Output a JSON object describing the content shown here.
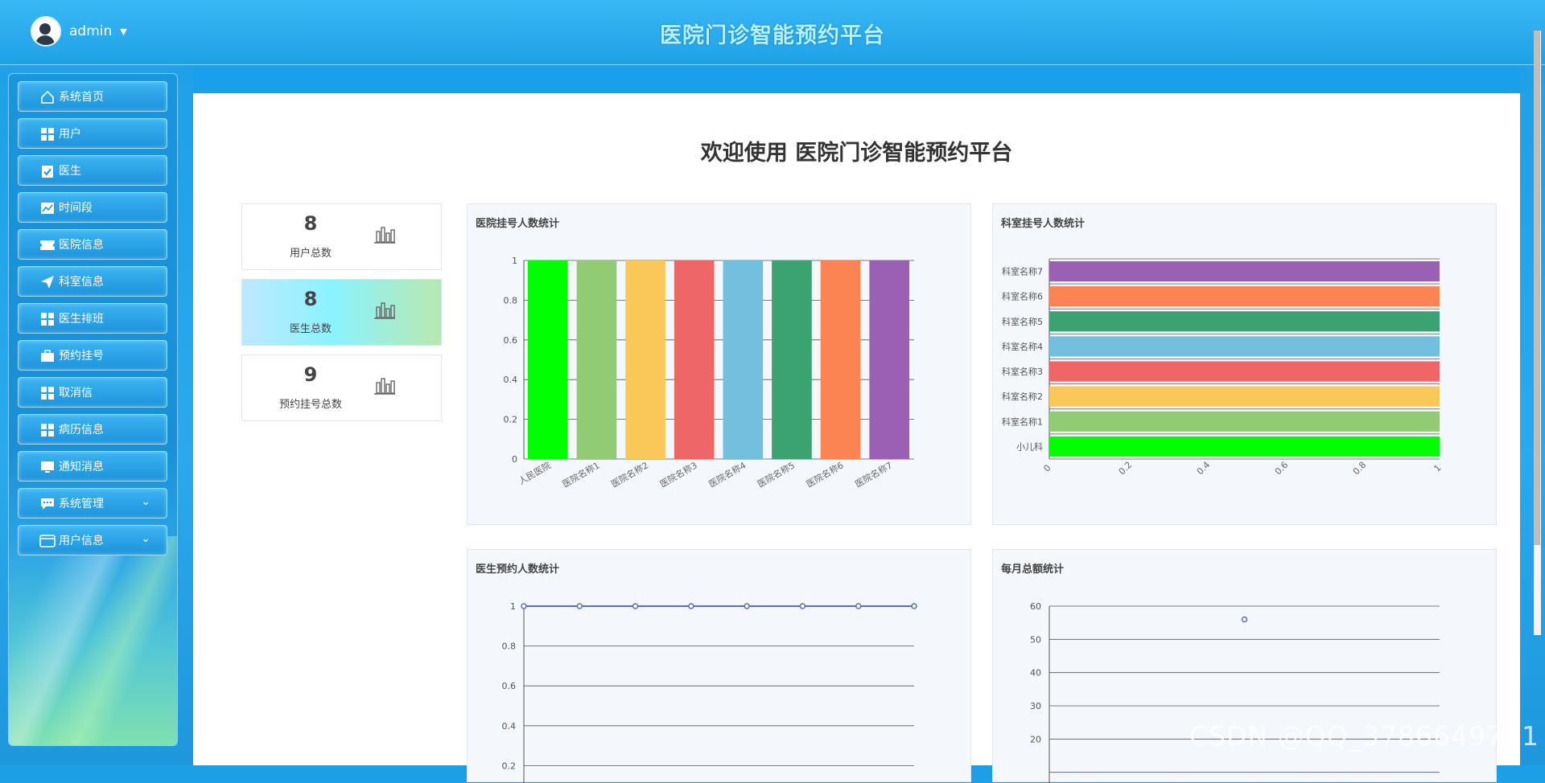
{
  "header": {
    "username": "admin",
    "caret": "▼",
    "app_title": "医院门诊智能预约平台"
  },
  "sidebar": {
    "items": [
      {
        "label": "系统首页",
        "icon": "home-icon"
      },
      {
        "label": "用户",
        "icon": "grid-icon"
      },
      {
        "label": "医生",
        "icon": "clipboard-icon"
      },
      {
        "label": "时间段",
        "icon": "trend-icon"
      },
      {
        "label": "医院信息",
        "icon": "ticket-icon"
      },
      {
        "label": "科室信息",
        "icon": "send-icon"
      },
      {
        "label": "医生排班",
        "icon": "grid-icon"
      },
      {
        "label": "预约挂号",
        "icon": "briefcase-icon"
      },
      {
        "label": "取消信",
        "icon": "grid-icon"
      },
      {
        "label": "病历信息",
        "icon": "grid-icon"
      },
      {
        "label": "通知消息",
        "icon": "monitor-icon"
      },
      {
        "label": "系统管理",
        "icon": "chat-icon",
        "expandable": true
      },
      {
        "label": "用户信息",
        "icon": "card-icon",
        "expandable": true
      }
    ]
  },
  "main": {
    "welcome": "欢迎使用 医院门诊智能预约平台",
    "stats": [
      {
        "value": "8",
        "label": "用户总数"
      },
      {
        "value": "8",
        "label": "医生总数"
      },
      {
        "value": "9",
        "label": "预约挂号总数"
      }
    ]
  },
  "chart_data": [
    {
      "type": "bar",
      "title": "医院挂号人数统计",
      "categories": [
        "人民医院",
        "医院名称1",
        "医院名称2",
        "医院名称3",
        "医院名称4",
        "医院名称5",
        "医院名称6",
        "医院名称7"
      ],
      "values": [
        1,
        1,
        1,
        1,
        1,
        1,
        1,
        1
      ],
      "colors": [
        "#00ff00",
        "#91cc75",
        "#fac858",
        "#ee6666",
        "#73c0de",
        "#3ba272",
        "#fc8452",
        "#9a60b4"
      ],
      "ylim": [
        0,
        1
      ],
      "yticks": [
        "0",
        "0.2",
        "0.4",
        "0.6",
        "0.8",
        "1"
      ]
    },
    {
      "type": "bar",
      "orientation": "horizontal",
      "title": "科室挂号人数统计",
      "categories": [
        "小儿科",
        "科室名称1",
        "科室名称2",
        "科室名称3",
        "科室名称4",
        "科室名称5",
        "科室名称6",
        "科室名称7"
      ],
      "category_labels_visible": [
        "小儿科",
        "科室名称1",
        "科室名称2",
        "科室名称3",
        "科室名称4",
        "科室名称5",
        "科室名称6",
        "科室名称7"
      ],
      "values": [
        1,
        1,
        1,
        1,
        1,
        1,
        1,
        1
      ],
      "colors": [
        "#00ff00",
        "#91cc75",
        "#fac858",
        "#ee6666",
        "#73c0de",
        "#3ba272",
        "#fc8452",
        "#9a60b4"
      ],
      "xlim": [
        0,
        1
      ],
      "xticks": [
        "0",
        "0.2",
        "0.4",
        "0.6",
        "0.8",
        "1"
      ]
    },
    {
      "type": "line",
      "title": "医生预约人数统计",
      "values": [
        1,
        1,
        1,
        1,
        1,
        1,
        1,
        1
      ],
      "ylim": [
        0,
        1
      ],
      "yticks_visible": [
        "0.2",
        "0.4",
        "0.6",
        "0.8",
        "1"
      ]
    },
    {
      "type": "scatter",
      "title": "每月总额统计",
      "points": [
        {
          "x": 1,
          "y": 56
        }
      ],
      "ylim": [
        0,
        60
      ],
      "yticks_visible": [
        "20",
        "30",
        "40",
        "50",
        "60"
      ]
    }
  ],
  "watermark": "CSDN @QQ_3786649731"
}
